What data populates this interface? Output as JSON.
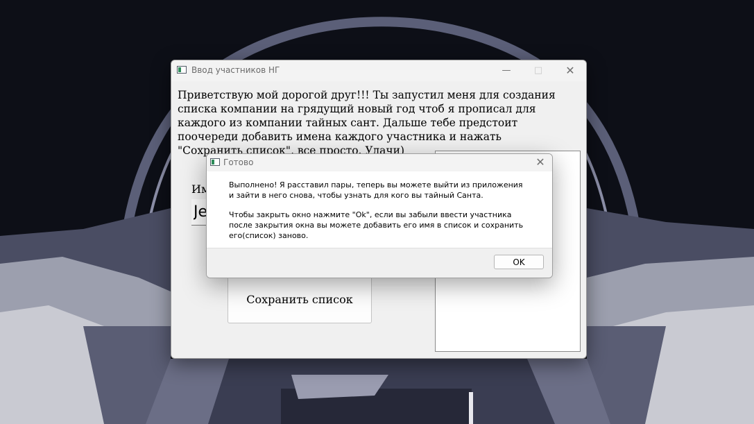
{
  "main_window": {
    "title": "Ввод участников НГ",
    "intro_text": "Приветствую мой дорогой друг!!! Ты запустил меня для создания списка компании на грядущий новый год чтоб я прописал для каждого из компании тайных сант. Дальше тебе предстоит поочереди добавить имена каждого участника и нажать \"Сохранить список\", все просто. Удачи)",
    "name_label": "Им",
    "name_input_value": "Je",
    "save_button_label": "Сохранить список"
  },
  "dialog": {
    "title": "Готово",
    "message_1": "Выполнено! Я расставил пары, теперь вы можете выйти из приложения и зайти в него снова, чтобы узнать для кого вы тайный Санта.",
    "message_2": "Чтобы закрыть окно нажмите \"Ok\", если вы забыли ввести участника после закрытия окна вы можете добавить его имя в список и сохранить его(список) заново.",
    "ok_label": "OK"
  },
  "colors": {
    "wallpaper_dark": "#0d0f17",
    "window_bg": "#f0f0f0",
    "dialog_bg": "#ffffff"
  }
}
